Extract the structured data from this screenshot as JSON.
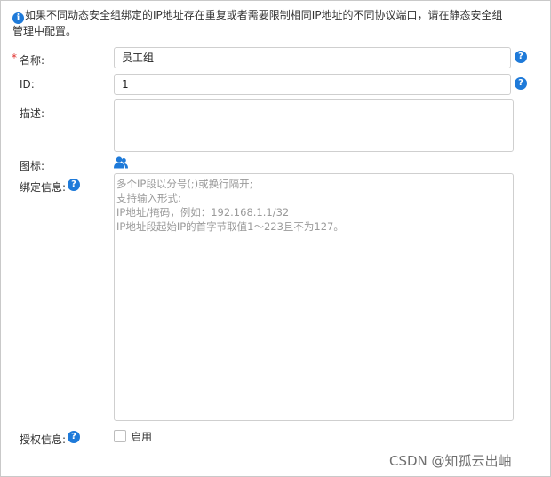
{
  "notice": {
    "line1": "如果不同动态安全组绑定的IP地址存在重复或者需要限制相同IP地址的不同协议端口，请在静态安全组",
    "line2": "管理中配置。"
  },
  "form": {
    "required_mark": "*",
    "name_label": "名称:",
    "name_value": "员工组",
    "id_label": "ID:",
    "id_value": "1",
    "desc_label": "描述:",
    "desc_value": "",
    "icon_label": "图标:",
    "icon_name": "user-group-icon",
    "binding_label": "绑定信息:",
    "binding_placeholder": [
      "多个IP段以分号(;)或换行隔开;",
      "支持输入形式:",
      "IP地址/掩码，例如：192.168.1.1/32",
      "IP地址段起始IP的首字节取值1～223且不为127。"
    ],
    "auth_label": "授权信息:",
    "auth_enable_label": "启用",
    "auth_enabled": false
  },
  "help_glyph": "?",
  "info_glyph": "i",
  "watermark": "CSDN @知孤云出岫",
  "colors": {
    "accent": "#1e7ad9",
    "required": "#e0302d"
  }
}
